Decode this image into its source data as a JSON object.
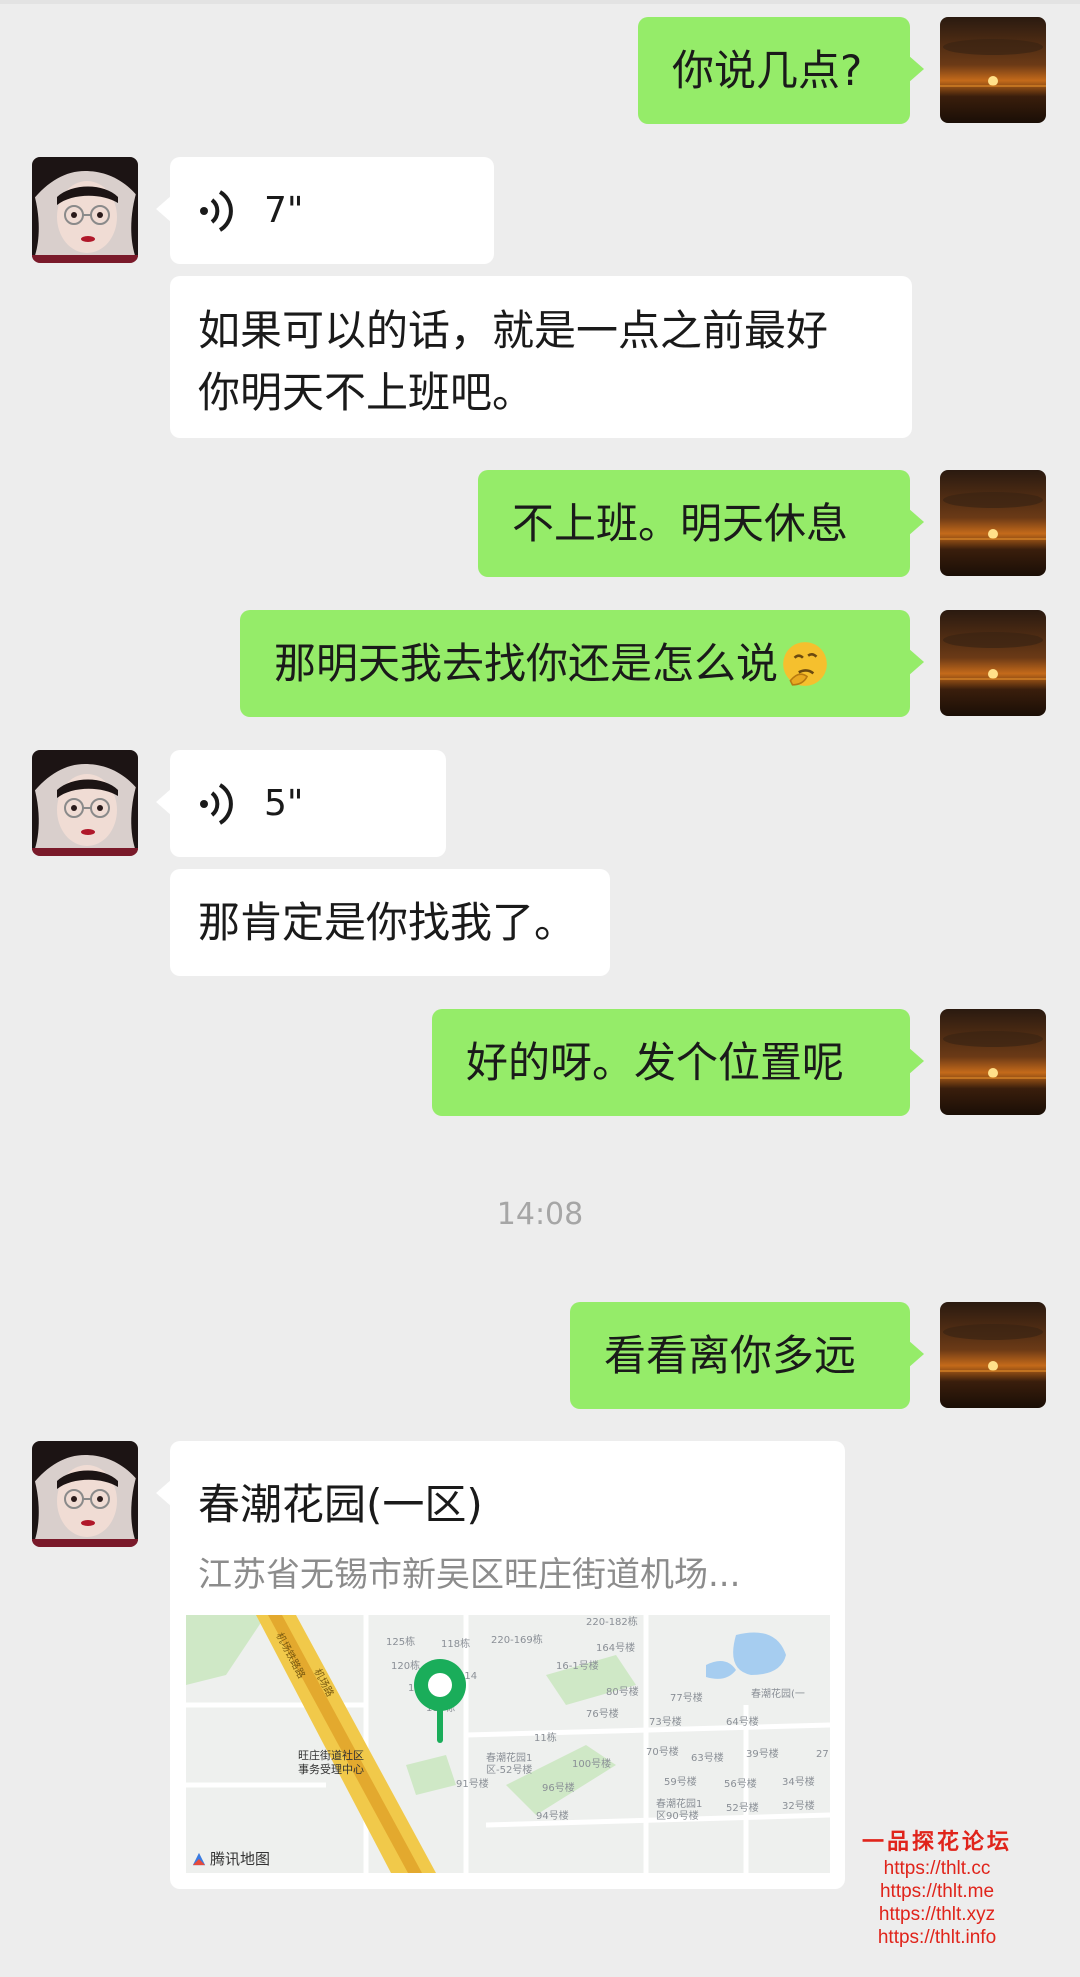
{
  "messages": {
    "m1": "你说几点?",
    "m2_voice": "7\"",
    "m3": [
      "如果可以的话，就是一点之前最好",
      "你明天不上班吧。"
    ],
    "m4": "不上班。明天休息",
    "m5": "那明天我去找你还是怎么说",
    "m6_voice": "5\"",
    "m7": "那肯定是你找我了。",
    "m8": "好的呀。发个位置呢",
    "m9": "看看离你多远"
  },
  "timestamp": "14:08",
  "location": {
    "title": "春潮花园(一区)",
    "address": "江苏省无锡市新吴区旺庄街道机场...",
    "map_credit": "腾讯地图",
    "map_labels": [
      "220-182栋",
      "125栋",
      "118栋",
      "220-169栋",
      "164号楼",
      "120栋",
      "16-1号楼",
      "115栋",
      "114",
      "110栋",
      "80号楼",
      "77号楼",
      "春潮花园(一",
      "76号楼",
      "73号楼",
      "64号楼",
      "11栋",
      "70号楼",
      "63号楼",
      "39号楼",
      "27",
      "100号楼",
      "59号楼",
      "56号楼",
      "34号楼",
      "91号楼",
      "96号楼",
      "春潮花园1区90号楼",
      "52号楼",
      "32号楼",
      "94号楼",
      "春潮花园1区-52号楼",
      "旺庄街道社区事务受理中心",
      "机场铁路路",
      "机场路"
    ]
  },
  "watermark": {
    "title": "一品探花论坛",
    "links": [
      "https://thlt.cc",
      "https://thlt.me",
      "https://thlt.xyz",
      "https://thlt.info"
    ]
  },
  "colors": {
    "bg": "#ededed",
    "sent_bubble": "#95ec69",
    "received_bubble": "#ffffff",
    "watermark": "#e0241b"
  }
}
